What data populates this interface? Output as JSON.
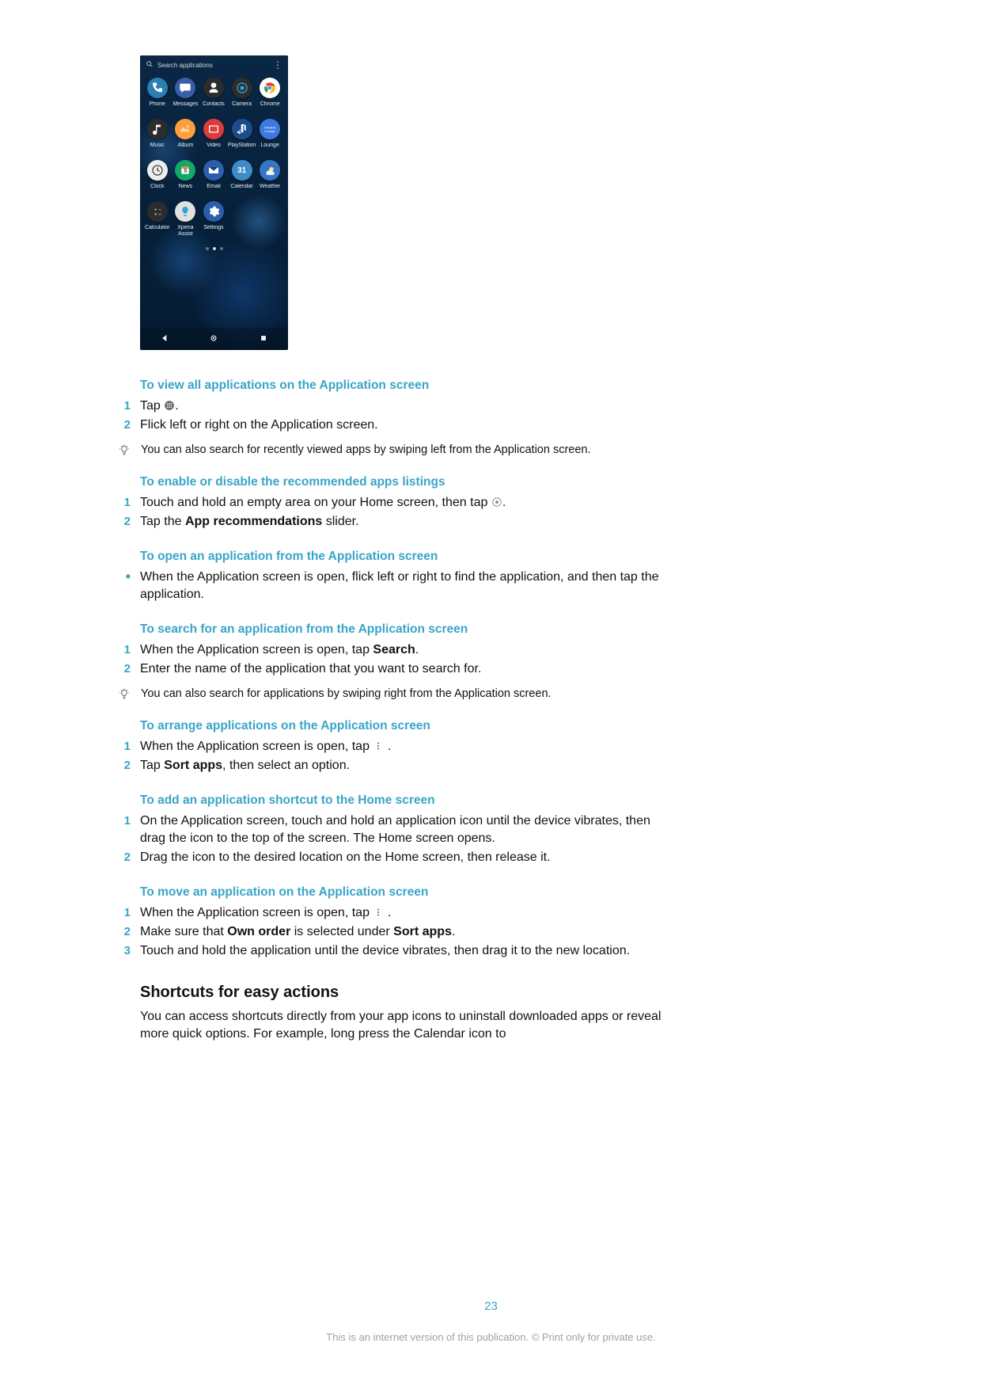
{
  "screenshot": {
    "search_placeholder": "Search applications",
    "apps": [
      {
        "name": "Phone",
        "bg": "#2a7fb3",
        "glyph": "phone",
        "fg": "#ffffff"
      },
      {
        "name": "Messages",
        "bg": "#3b5da8",
        "glyph": "msg",
        "fg": "#ffffff"
      },
      {
        "name": "Contacts",
        "bg": "#2c2c2c",
        "glyph": "person",
        "fg": "#ffffff"
      },
      {
        "name": "Camera",
        "bg": "#2c2c2c",
        "glyph": "camera",
        "fg": "#2aa6d9"
      },
      {
        "name": "Chrome",
        "bg": "#ffffff",
        "glyph": "chrome",
        "fg": "#000000"
      },
      {
        "name": "Music",
        "bg": "#2c2c2c",
        "glyph": "music",
        "fg": "#ffffff"
      },
      {
        "name": "Album",
        "bg": "#ff9e3d",
        "glyph": "album",
        "fg": "#ffffff"
      },
      {
        "name": "Video",
        "bg": "#de3b3b",
        "glyph": "video",
        "fg": "#ffffff"
      },
      {
        "name": "PlayStation",
        "bg": "#1b4d8a",
        "glyph": "ps",
        "fg": "#ffffff"
      },
      {
        "name": "Lounge",
        "bg": "#3e79e0",
        "glyph": "lounge",
        "fg": "#ffffff"
      },
      {
        "name": "Clock",
        "bg": "#eeeeee",
        "glyph": "clock",
        "fg": "#444444"
      },
      {
        "name": "News",
        "bg": "#12a86b",
        "glyph": "news",
        "fg": "#ffffff"
      },
      {
        "name": "Email",
        "bg": "#2d5dad",
        "glyph": "email",
        "fg": "#ffffff"
      },
      {
        "name": "Calendar",
        "bg": "#3d8cc7",
        "glyph": "cal",
        "fg": "#ffffff",
        "badge": "31"
      },
      {
        "name": "Weather",
        "bg": "#3676c7",
        "glyph": "weather",
        "fg": "#ffe27a"
      },
      {
        "name": "Calculator",
        "bg": "#2c2c2c",
        "glyph": "calc",
        "fg": "#ffffff"
      },
      {
        "name": "Xperia Assist",
        "bg": "#e0e0e0",
        "glyph": "bulb",
        "fg": "#2aa6d9"
      },
      {
        "name": "Settings",
        "bg": "#2d5dad",
        "glyph": "gear",
        "fg": "#ffffff"
      }
    ]
  },
  "sections": {
    "s1": {
      "title": "To view all applications on the Application screen",
      "step1_a": "Tap ",
      "step1_b": ".",
      "step2": "Flick left or right on the Application screen.",
      "tip": "You can also search for recently viewed apps by swiping left from the Application screen."
    },
    "s2": {
      "title": "To enable or disable the recommended apps listings",
      "step1_a": "Touch and hold an empty area on your Home screen, then tap ",
      "step1_b": ".",
      "step2_a": "Tap the ",
      "step2_b": "App recommendations",
      "step2_c": " slider."
    },
    "s3": {
      "title": "To open an application from the Application screen",
      "bullet": "When the Application screen is open, flick left or right to find the application, and then tap the application."
    },
    "s4": {
      "title": "To search for an application from the Application screen",
      "step1_a": "When the Application screen is open, tap ",
      "step1_b": "Search",
      "step1_c": ".",
      "step2": "Enter the name of the application that you want to search for.",
      "tip": "You can also search for applications by swiping right from the Application screen."
    },
    "s5": {
      "title": "To arrange applications on the Application screen",
      "step1_a": "When the Application screen is open, tap ",
      "step1_b": " .",
      "step2_a": "Tap ",
      "step2_b": "Sort apps",
      "step2_c": ", then select an option."
    },
    "s6": {
      "title": "To add an application shortcut to the Home screen",
      "step1": "On the Application screen, touch and hold an application icon until the device vibrates, then drag the icon to the top of the screen. The Home screen opens.",
      "step2": "Drag the icon to the desired location on the Home screen, then release it."
    },
    "s7": {
      "title": "To move an application on the Application screen",
      "step1_a": "When the Application screen is open, tap ",
      "step1_b": " .",
      "step2_a": "Make sure that ",
      "step2_b": "Own order",
      "step2_c": " is selected under ",
      "step2_d": "Sort apps",
      "step2_e": ".",
      "step3": "Touch and hold the application until the device vibrates, then drag it to the new location."
    }
  },
  "shortcuts": {
    "heading": "Shortcuts for easy actions",
    "para": "You can access shortcuts directly from your app icons to uninstall downloaded apps or reveal more quick options. For example, long press the Calendar icon to"
  },
  "page_number": "23",
  "footer": "This is an internet version of this publication. © Print only for private use."
}
